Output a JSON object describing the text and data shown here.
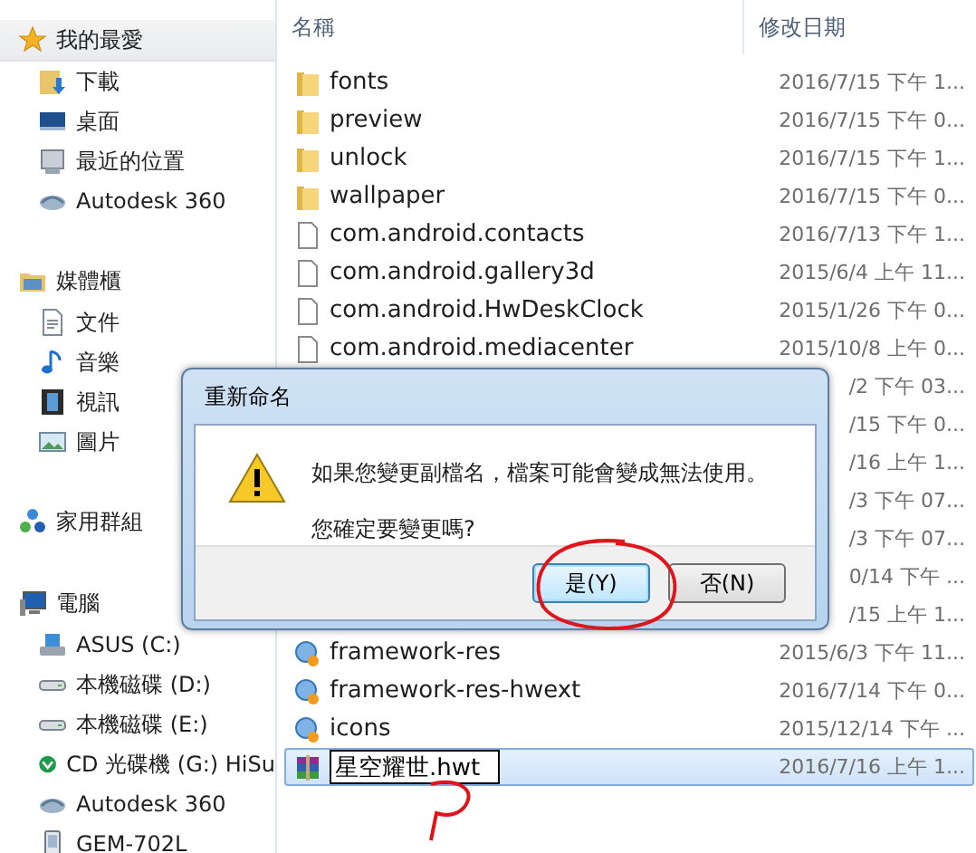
{
  "sidebar": {
    "groups": [
      {
        "label": "我的最愛",
        "kind": "star",
        "selected": true,
        "items": [
          {
            "label": "下載",
            "kind": "download"
          },
          {
            "label": "桌面",
            "kind": "desktop"
          },
          {
            "label": "最近的位置",
            "kind": "recent"
          },
          {
            "label": "Autodesk 360",
            "kind": "cloud"
          }
        ]
      },
      {
        "label": "媒體櫃",
        "kind": "library",
        "selected": false,
        "items": [
          {
            "label": "文件",
            "kind": "document"
          },
          {
            "label": "音樂",
            "kind": "music"
          },
          {
            "label": "視訊",
            "kind": "video"
          },
          {
            "label": "圖片",
            "kind": "picture"
          }
        ]
      },
      {
        "label": "家用群組",
        "kind": "homegroup",
        "selected": false
      },
      {
        "label": "電腦",
        "kind": "computer",
        "selected": false,
        "items": [
          {
            "label": "ASUS (C:)",
            "kind": "system-drive"
          },
          {
            "label": "本機磁碟 (D:)",
            "kind": "drive"
          },
          {
            "label": "本機磁碟 (E:)",
            "kind": "drive"
          },
          {
            "label": "CD 光碟機 (G:) HiSu",
            "kind": "cd"
          },
          {
            "label": "Autodesk 360",
            "kind": "cloud"
          },
          {
            "label": "GEM-702L",
            "kind": "phone"
          }
        ]
      }
    ]
  },
  "file_list": {
    "columns": [
      "名稱",
      "修改日期"
    ],
    "rows": [
      {
        "kind": "folder",
        "name": "fonts",
        "date": "2016/7/15 下午 1...",
        "selected": false
      },
      {
        "kind": "folder",
        "name": "preview",
        "date": "2016/7/15 下午 0...",
        "selected": false
      },
      {
        "kind": "folder",
        "name": "unlock",
        "date": "2016/7/15 下午 1...",
        "selected": false
      },
      {
        "kind": "folder",
        "name": "wallpaper",
        "date": "2016/7/15 下午 0...",
        "selected": false
      },
      {
        "kind": "file",
        "name": "com.android.contacts",
        "date": "2016/7/13 下午 1...",
        "selected": false
      },
      {
        "kind": "file",
        "name": "com.android.gallery3d",
        "date": "2015/6/4 上午 11...",
        "selected": false
      },
      {
        "kind": "file",
        "name": "com.android.HwDeskClock",
        "date": "2015/1/26 下午 0...",
        "selected": false
      },
      {
        "kind": "file",
        "name": "com.android.mediacenter",
        "date": "2015/10/8 上午 0...",
        "selected": false
      },
      {
        "kind": "hidden",
        "date": "/2 下午 03...",
        "selected": false
      },
      {
        "kind": "hidden",
        "date": "/15 下午 0...",
        "selected": false
      },
      {
        "kind": "hidden",
        "date": "/16 上午 1...",
        "selected": false
      },
      {
        "kind": "hidden",
        "date": "/3 下午 07...",
        "selected": false
      },
      {
        "kind": "hidden",
        "date": "/3 下午 07...",
        "selected": false
      },
      {
        "kind": "hidden",
        "date": "0/14 下午 ...",
        "selected": false
      },
      {
        "kind": "hidden",
        "date": "/15 上午 1...",
        "selected": false
      },
      {
        "kind": "theme",
        "name": "framework-res",
        "date": "2015/6/3 下午 11...",
        "selected": false
      },
      {
        "kind": "theme",
        "name": "framework-res-hwext",
        "date": "2016/7/14 下午 0...",
        "selected": false
      },
      {
        "kind": "theme",
        "name": "icons",
        "date": "2015/12/14 下午 ...",
        "selected": false
      },
      {
        "kind": "archive",
        "rename_value": "星空耀世.hwt",
        "date": "2016/7/16 上午 1...",
        "selected": true
      }
    ]
  },
  "dialog": {
    "title": "重新命名",
    "message": "如果您變更副檔名，檔案可能會變成無法使用。",
    "question": "您確定要變更嗎?",
    "buttons": [
      {
        "label": "是(Y)",
        "default": true
      },
      {
        "label": "否(N)",
        "default": false
      }
    ]
  }
}
